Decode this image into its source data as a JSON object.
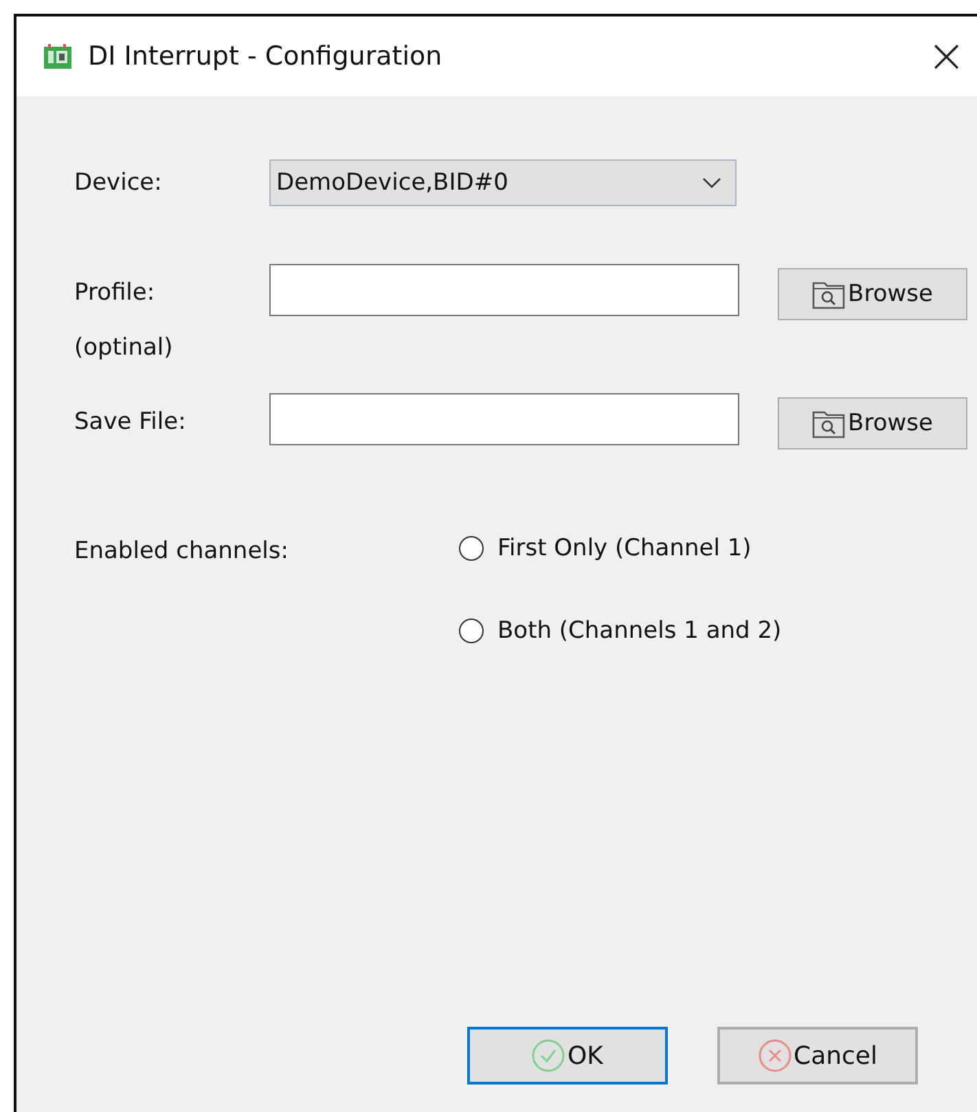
{
  "window": {
    "title": "DI Interrupt - Configuration",
    "close": "×"
  },
  "device": {
    "label": "Device:",
    "value": "DemoDevice,BID#0"
  },
  "file_rows": [
    {
      "label": "Profile:",
      "sublabel": "(optinal)",
      "button": "Browse"
    },
    {
      "label": "Save File:",
      "button": "Browse"
    }
  ],
  "channels": {
    "label": "Enabled channels:",
    "options": [
      {
        "label": "First Only (Channel 1)",
        "selected": false
      },
      {
        "label": "Both (Channels 1 and 2)",
        "selected": false
      }
    ]
  },
  "buttons": [
    {
      "label": "OK",
      "kind": "ok",
      "default": true
    },
    {
      "label": "Cancel",
      "kind": "cancel",
      "default": false
    }
  ]
}
